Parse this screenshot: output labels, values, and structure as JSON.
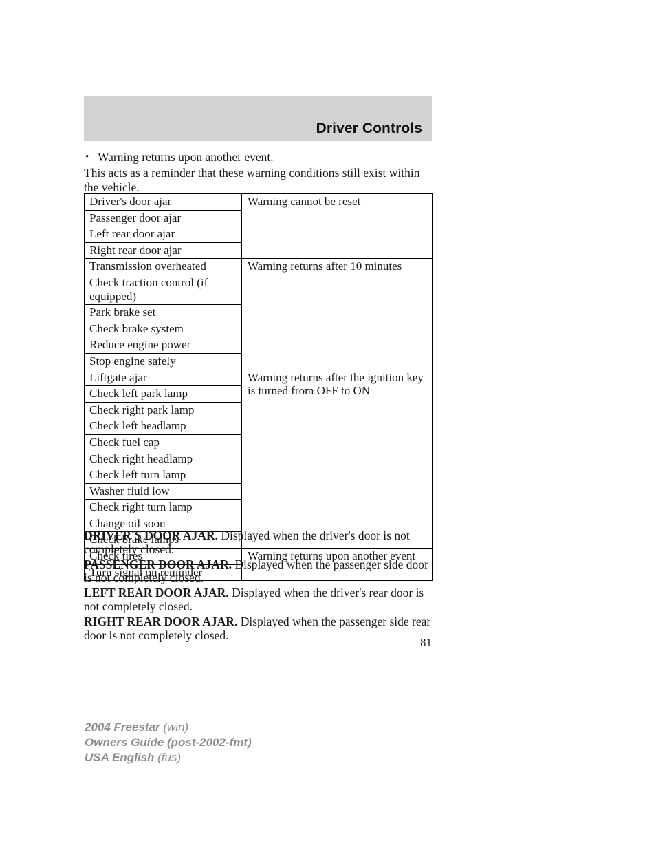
{
  "header": {
    "title": "Driver Controls"
  },
  "intro": {
    "bullet_glyph": "•",
    "bullet_text": "Warning returns upon another event.",
    "paragraph": "This acts as a reminder that these warning conditions still exist within the vehicle."
  },
  "table": {
    "groups": [
      {
        "behavior": "Warning cannot be reset",
        "warnings": [
          "Driver's door ajar",
          "Passenger door ajar",
          "Left rear door ajar",
          "Right rear door ajar"
        ]
      },
      {
        "behavior": "Warning returns after 10 minutes",
        "warnings": [
          "Transmission overheated",
          "Check traction control (if equipped)",
          "Park brake set",
          "Check brake system",
          "Reduce engine power",
          "Stop engine safely"
        ]
      },
      {
        "behavior": "Warning returns after the ignition key is turned from OFF to ON",
        "warnings": [
          "Liftgate ajar",
          "Check left park lamp",
          "Check right park lamp",
          "Check left headlamp",
          "Check fuel cap",
          "Check right headlamp",
          "Check left turn lamp",
          "Washer fluid low",
          "Check right turn lamp",
          "Change oil soon",
          "Check brake lamps"
        ]
      },
      {
        "behavior": "Warning returns upon another event",
        "warnings": [
          "Check tires",
          "Turn signal on reminder"
        ]
      }
    ]
  },
  "definitions": [
    {
      "term": "DRIVER'S DOOR AJAR.",
      "description": "Displayed when the driver's door is not completely closed."
    },
    {
      "term": "PASSENGER DOOR AJAR.",
      "description": "Displayed when the passenger side door is not completely closed."
    },
    {
      "term": "LEFT REAR DOOR AJAR.",
      "description": "Displayed when the driver's rear door is not completely closed."
    },
    {
      "term": "RIGHT REAR DOOR AJAR.",
      "description": "Displayed when the passenger side rear door is not completely closed."
    }
  ],
  "page_number": "81",
  "footer": {
    "lines": [
      {
        "strong": "2004 Freestar",
        "light": " (win)"
      },
      {
        "strong": "Owners Guide (post-2002-fmt)",
        "light": ""
      },
      {
        "strong": "USA English",
        "light": " (fus)"
      }
    ]
  }
}
